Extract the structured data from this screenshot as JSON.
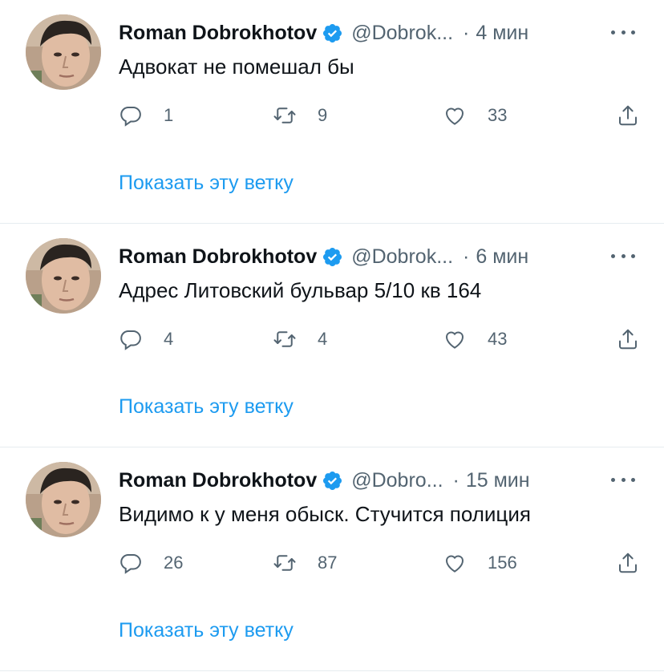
{
  "tweets": [
    {
      "author_name": "Roman Dobrokhotov",
      "handle": "@Dobrok...",
      "separator": "·",
      "time": "4 мин",
      "text": "Адвокат не помешал бы",
      "reply_count": "1",
      "retweet_count": "9",
      "like_count": "33",
      "thread_link": "Показать эту ветку"
    },
    {
      "author_name": "Roman Dobrokhotov",
      "handle": "@Dobrok...",
      "separator": "·",
      "time": "6 мин",
      "text": "Адрес Литовский бульвар 5/10 кв 164",
      "reply_count": "4",
      "retweet_count": "4",
      "like_count": "43",
      "thread_link": "Показать эту ветку"
    },
    {
      "author_name": "Roman Dobrokhotov",
      "handle": "@Dobro...",
      "separator": "·",
      "time": "15 мин",
      "text": "Видимо к у меня обыск. Стучится полиция",
      "reply_count": "26",
      "retweet_count": "87",
      "like_count": "156",
      "thread_link": "Показать эту ветку"
    }
  ],
  "icons": {
    "verified": "verified-badge-icon",
    "more": "more-options-icon",
    "reply": "reply-icon",
    "retweet": "retweet-icon",
    "like": "heart-icon",
    "share": "share-icon"
  },
  "colors": {
    "link": "#1d9bf0",
    "secondary_text": "#536471",
    "verified": "#1d9bf0",
    "divider": "#e6ecf0"
  }
}
